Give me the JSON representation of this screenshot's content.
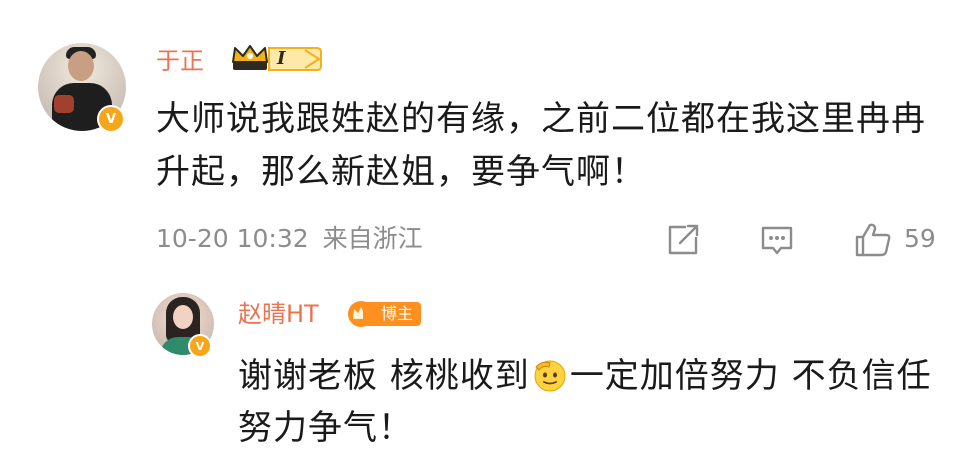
{
  "comment": {
    "username": "于正",
    "level_badge_text": "I",
    "level_badge_icon": "crown-icon",
    "verified_badge": "V",
    "text": "大师说我跟姓赵的有缘，之前二位都在我这里冉冉升起，那么新赵姐，要争气啊！",
    "date_time": "10-20 10:32",
    "location": "来自浙江",
    "like_count": "59",
    "actions": [
      "share-icon",
      "comment-icon",
      "like-icon"
    ]
  },
  "reply": {
    "username": "赵晴HT",
    "badge_label": "博主",
    "verified_badge": "V",
    "text_part1": "谢谢老板 核桃收到",
    "emoji": "salute-face-emoji",
    "text_part2": "一定加倍努力 不负信任 努力争气！"
  },
  "colors": {
    "username": "#eb7350",
    "meta": "#8c8c8c",
    "verified": "#f7a619",
    "blogger_badge": "#ff8f1f",
    "crown_badge": "#f2b11b"
  }
}
